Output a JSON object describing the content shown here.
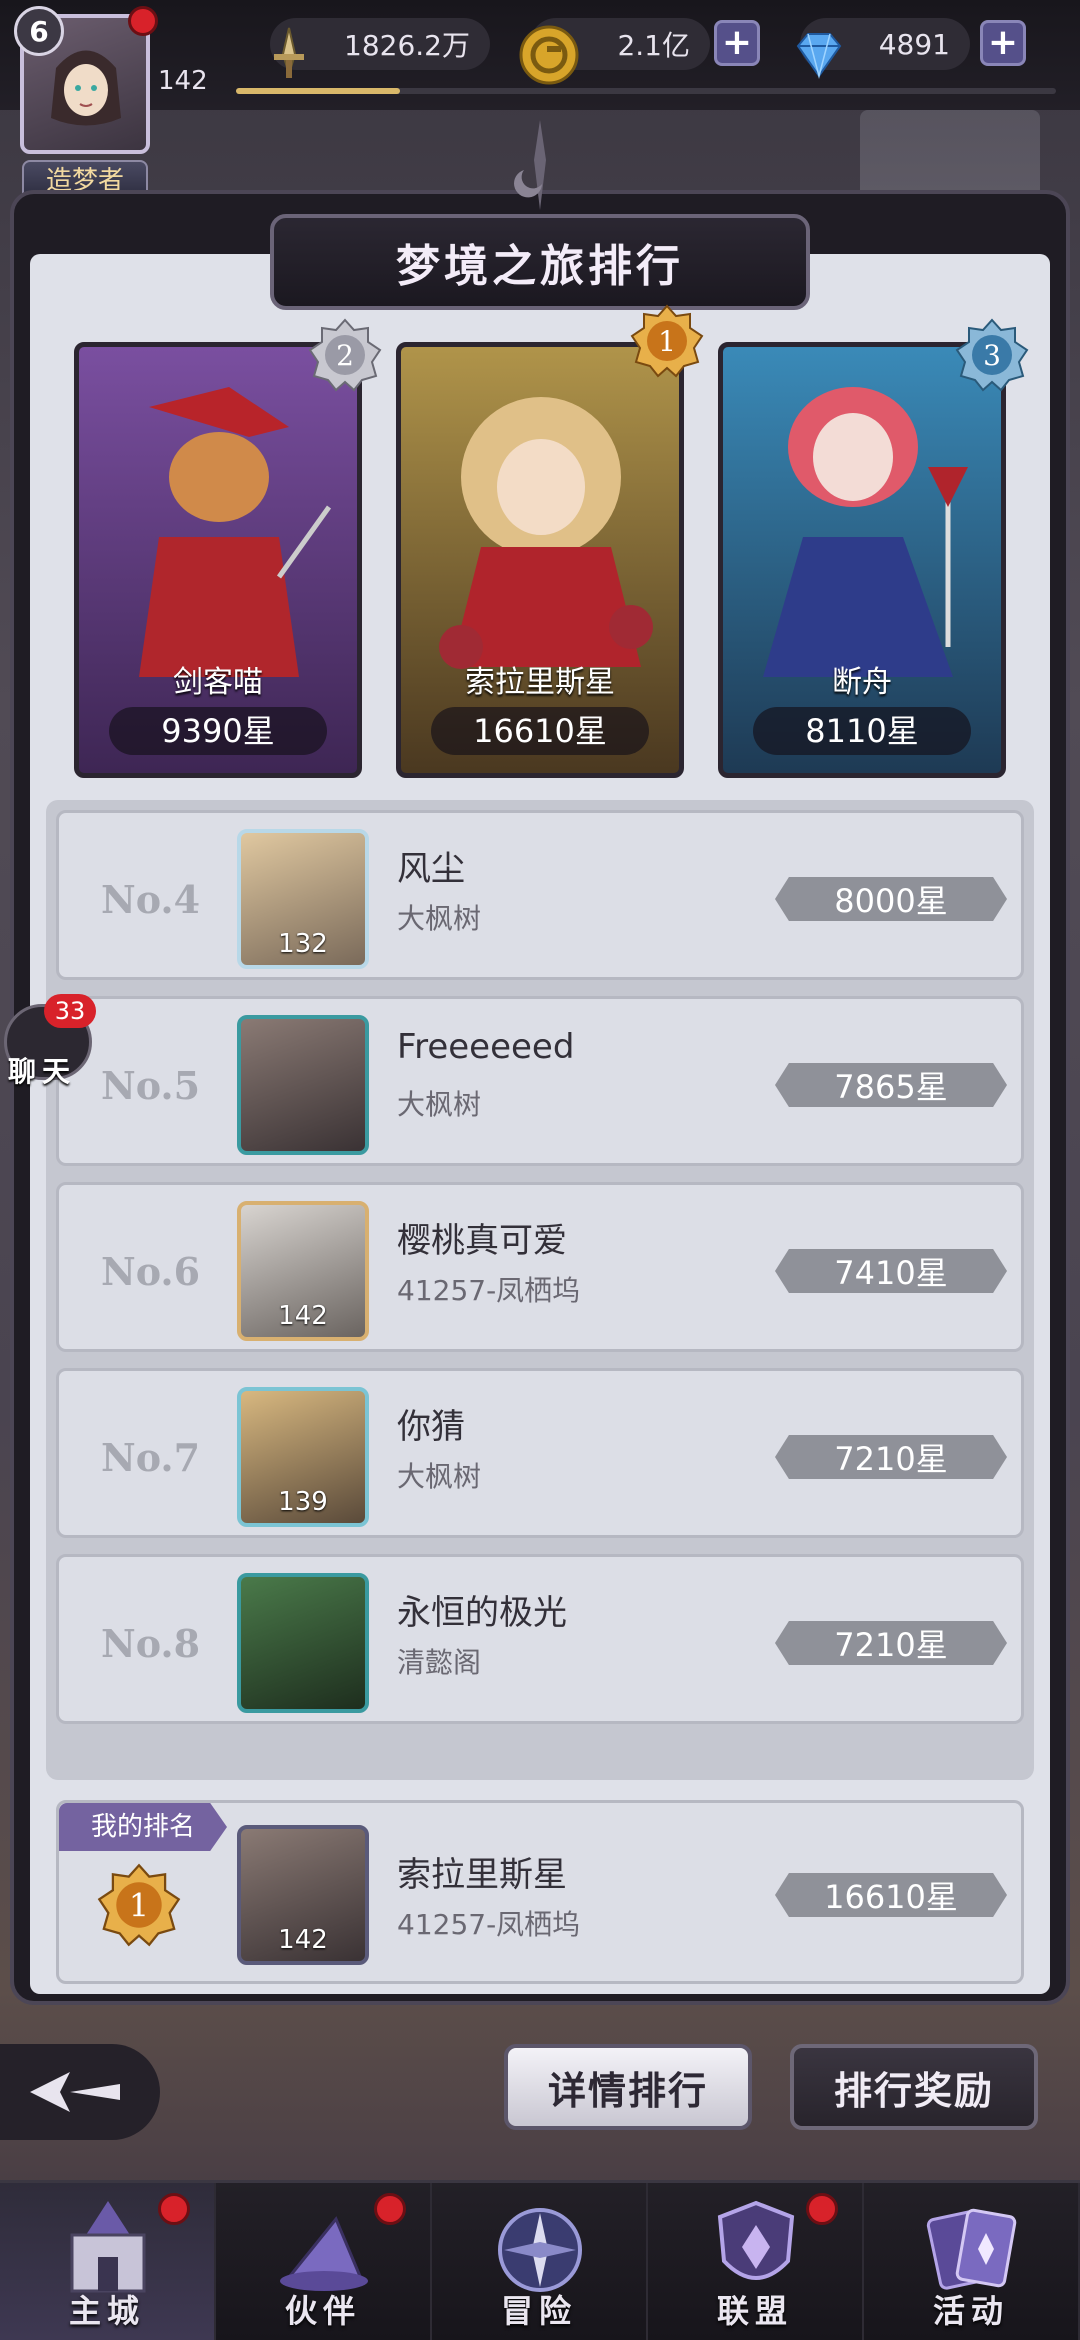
{
  "player": {
    "level_badge": "6",
    "level": "142",
    "title": "造梦者",
    "xp_fraction": 0.2
  },
  "resources": [
    {
      "icon": "sword-power-icon",
      "value": "1826.2万"
    },
    {
      "icon": "gold-coin-icon",
      "value": "2.1亿"
    },
    {
      "icon": "diamond-icon",
      "value": "4891"
    }
  ],
  "panel": {
    "title": "梦境之旅排行"
  },
  "podium": [
    {
      "rank_icon": "2",
      "name": "剑客喵",
      "score": "9390星",
      "color": "#6a4a8c"
    },
    {
      "rank_icon": "1",
      "name": "索拉里斯星",
      "score": "16610星",
      "color": "#8a6a2c"
    },
    {
      "rank_icon": "3",
      "name": "断舟",
      "score": "8110星",
      "color": "#2e6a8a"
    }
  ],
  "ranking": [
    {
      "rank": "No.4",
      "name": "风尘",
      "guild": "大枫树",
      "level": "132",
      "score": "8000星"
    },
    {
      "rank": "No.5",
      "name": "Freeeeeed",
      "guild": "大枫树",
      "level": "",
      "score": "7865星"
    },
    {
      "rank": "No.6",
      "name": "樱桃真可爱",
      "guild": "41257-凤栖坞",
      "level": "142",
      "score": "7410星"
    },
    {
      "rank": "No.7",
      "name": "你猜",
      "guild": "大枫树",
      "level": "139",
      "score": "7210星"
    },
    {
      "rank": "No.8",
      "name": "永恒的极光",
      "guild": "清懿阁",
      "level": "",
      "score": "7210星"
    }
  ],
  "my_rank": {
    "tag": "我的排名",
    "rank": "1",
    "name": "索拉里斯星",
    "guild": "41257-凤栖坞",
    "level": "142",
    "score": "16610星"
  },
  "chat": {
    "count": "33",
    "label": "聊天"
  },
  "buttons": {
    "detail": "详情排行",
    "reward": "排行奖励"
  },
  "nav": [
    {
      "label": "主城",
      "icon": "castle-icon",
      "dot": true
    },
    {
      "label": "伙伴",
      "icon": "wizard-hat-icon",
      "dot": true
    },
    {
      "label": "冒险",
      "icon": "compass-icon",
      "dot": false
    },
    {
      "label": "联盟",
      "icon": "shield-icon",
      "dot": true
    },
    {
      "label": "活动",
      "icon": "cards-icon",
      "dot": false
    }
  ],
  "colors": {
    "accent_purple": "#55508a",
    "badge_red": "#d8222a",
    "gold": "#d9b86a"
  }
}
